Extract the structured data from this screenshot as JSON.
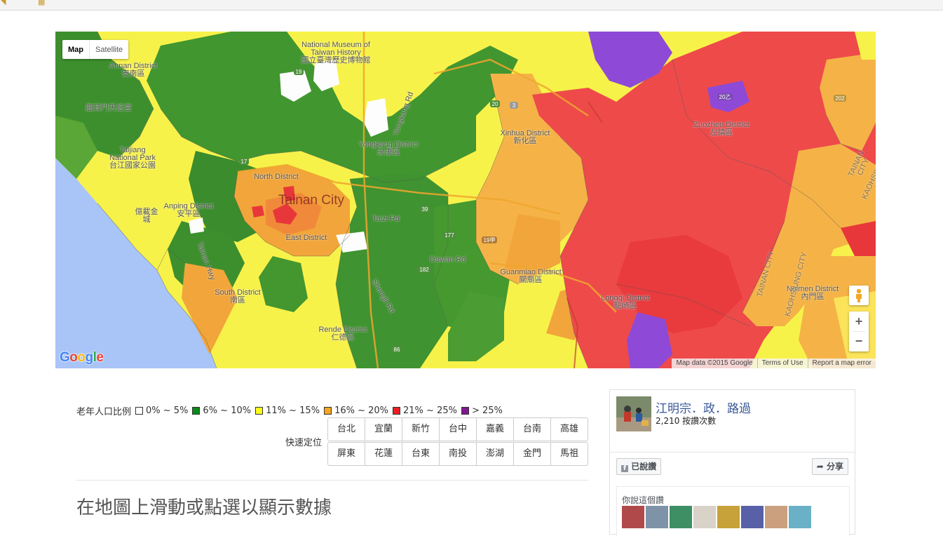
{
  "map": {
    "map_type_buttons": [
      "Map",
      "Satellite"
    ],
    "active_map_type": "Map",
    "zoom_in": "+",
    "zoom_out": "−",
    "google_logo": "Google",
    "attribution": [
      "Map data ©2015 Google",
      "Terms of Use",
      "Report a map error"
    ],
    "big_label": "Tainan City",
    "place_labels": [
      {
        "en": "National Museum of Taiwan History",
        "zh": "國立臺灣歷史博物館"
      },
      {
        "en": "Annan District",
        "zh": "安南區"
      },
      {
        "en": "",
        "zh": "鹿耳門天后宮"
      },
      {
        "en": "Taijiang National Park",
        "zh": "台江國家公園"
      },
      {
        "en": "North District",
        "zh": ""
      },
      {
        "en": "Yongkang District",
        "zh": "永康區"
      },
      {
        "en": "Xinhua District",
        "zh": "新化區"
      },
      {
        "en": "Zuozhen District",
        "zh": "左鎮區"
      },
      {
        "en": "Anping District",
        "zh": "安平區"
      },
      {
        "en": "East District",
        "zh": ""
      },
      {
        "en": "South District",
        "zh": "南區"
      },
      {
        "en": "Guanmiao District",
        "zh": "關廟區"
      },
      {
        "en": "Longqi District",
        "zh": "龍崎區"
      },
      {
        "en": "Neimen District",
        "zh": "內門區"
      },
      {
        "en": "Rende District",
        "zh": "仁德區"
      },
      {
        "en": "",
        "zh": "億載金城"
      }
    ],
    "road_labels": [
      "Yongkang Rd",
      "Taizi Rd",
      "Dawan Rd",
      "Shengli Rd",
      "Tainan Hwy"
    ],
    "right_vertical_labels": [
      "TAINAN CITY",
      "KAOHSIUNG CITY"
    ],
    "route_shields": [
      "19",
      "20",
      "3",
      "17",
      "177",
      "39",
      "182",
      "86",
      "19甲",
      "20乙",
      "202"
    ]
  },
  "legend": {
    "label": "老年人口比例",
    "items": [
      {
        "range": "0% ~ 5%",
        "color": "#ffffff"
      },
      {
        "range": "6% ~ 10%",
        "color": "#0a8a18"
      },
      {
        "range": "11% ~ 15%",
        "color": "#ffff1a"
      },
      {
        "range": "16% ~ 20%",
        "color": "#f5a623"
      },
      {
        "range": "21% ~ 25%",
        "color": "#ee1c24"
      },
      {
        "range": "> 25%",
        "color": "#7d1a8c"
      }
    ]
  },
  "quick_locate": {
    "label": "快速定位",
    "row1": [
      "台北",
      "宜蘭",
      "新竹",
      "台中",
      "嘉義",
      "台南",
      "高雄"
    ],
    "row2": [
      "屏東",
      "花蓮",
      "台東",
      "南投",
      "澎湖",
      "金門",
      "馬祖"
    ]
  },
  "hint": "在地圖上滑動或點選以顯示數據",
  "fb": {
    "page_name": "江明宗．政．路過",
    "like_count": "2,210 按讚次數",
    "liked_button": "已說讚",
    "share_button": "分享",
    "friends_label": "你說這個讚"
  }
}
